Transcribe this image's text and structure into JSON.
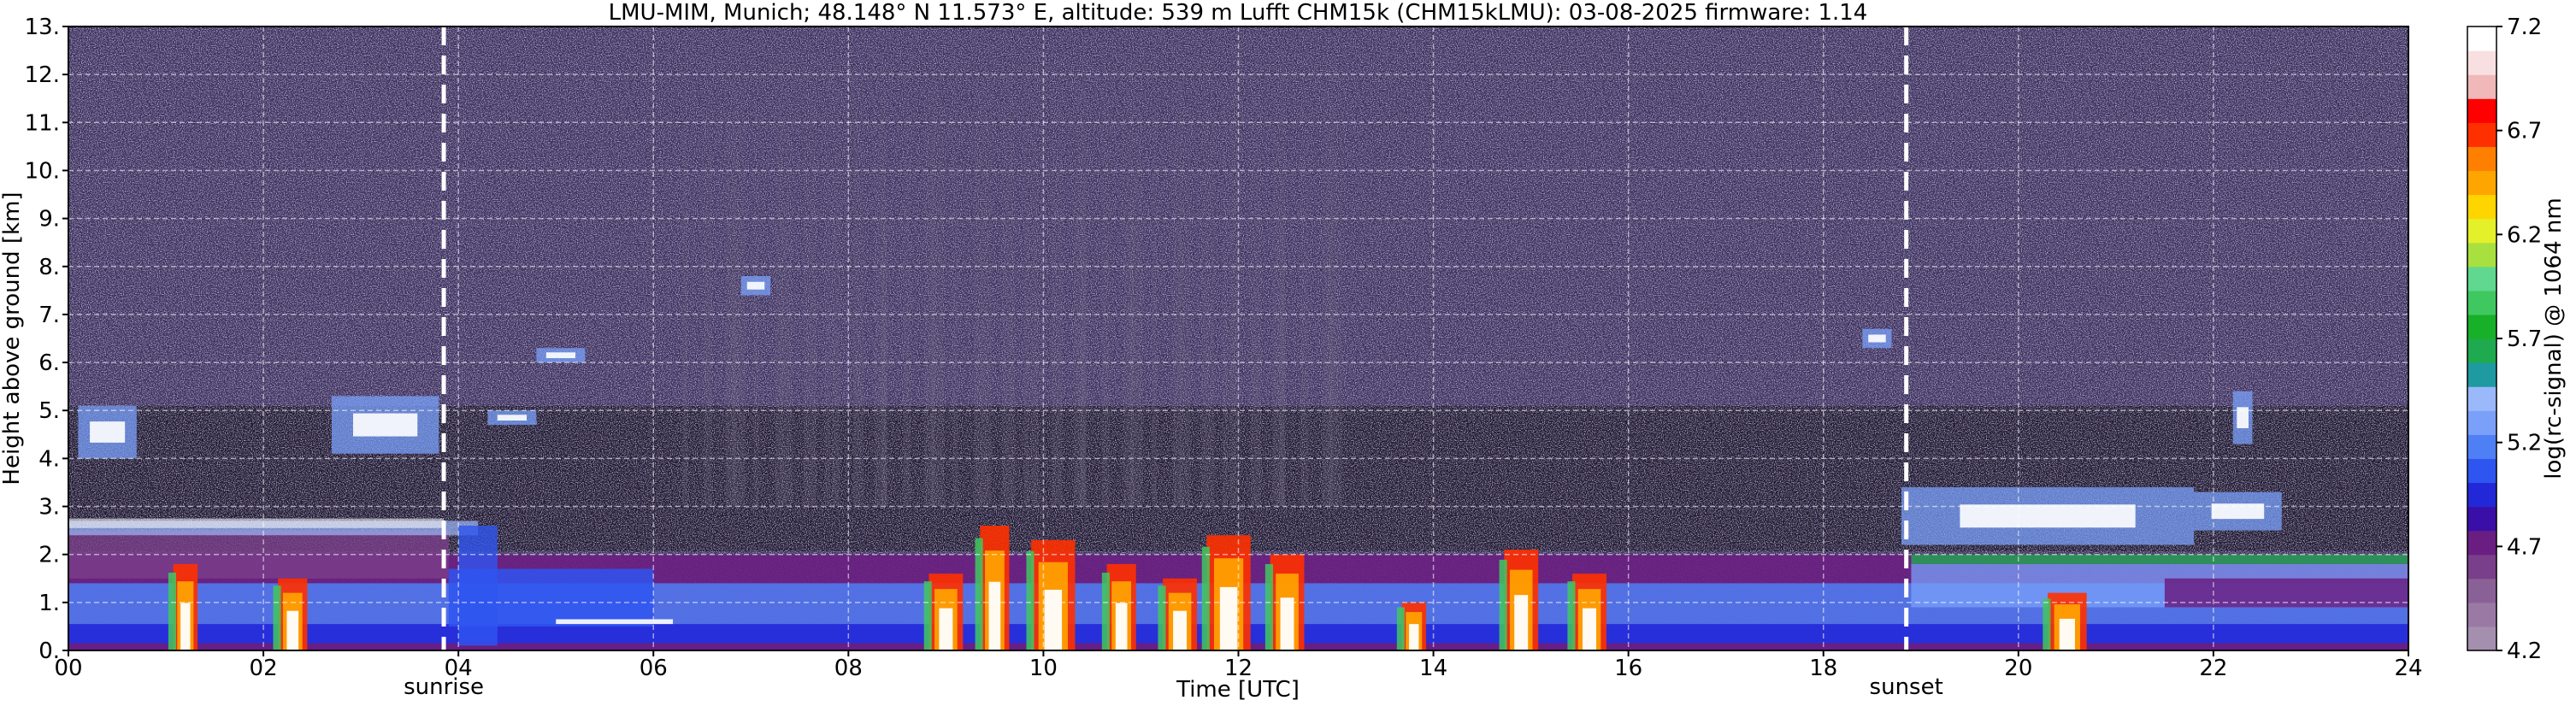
{
  "chart_data": {
    "type": "heatmap",
    "title": "LMU-MIM, Munich; 48.148° N 11.573° E, altitude: 539 m    Lufft CHM15k (CHM15kLMU): 03-08-2025    firmware: 1.14",
    "xlabel": "Time [UTC]",
    "ylabel": "Height above ground [km]",
    "xlim": [
      0,
      24
    ],
    "ylim": [
      0,
      13
    ],
    "x_ticks": [
      0,
      2,
      4,
      6,
      8,
      10,
      12,
      14,
      16,
      18,
      20,
      22,
      24
    ],
    "x_tick_labels": [
      "00",
      "02",
      "04",
      "06",
      "08",
      "10",
      "12",
      "14",
      "16",
      "18",
      "20",
      "22",
      "24"
    ],
    "y_ticks": [
      0,
      1,
      2,
      3,
      4,
      5,
      6,
      7,
      8,
      9,
      10,
      11,
      12,
      13
    ],
    "y_tick_labels": [
      "0.",
      "1.",
      "2.",
      "3.",
      "4.",
      "5.",
      "6.",
      "7.",
      "8.",
      "9.",
      "10.",
      "11.",
      "12.",
      "13."
    ],
    "grid": true,
    "markers": [
      {
        "label": "sunrise",
        "time": 3.85
      },
      {
        "label": "sunset",
        "time": 18.85
      }
    ],
    "colorbar": {
      "label": "log(rc-signal) @ 1064 nm",
      "range": [
        4.2,
        7.2
      ],
      "ticks": [
        4.2,
        4.7,
        5.2,
        5.7,
        6.2,
        6.7,
        7.2
      ],
      "tick_labels": [
        "4.2",
        "4.7",
        "5.2",
        "5.7",
        "6.2",
        "6.7",
        "7.2"
      ],
      "colors": [
        "#a58fae",
        "#9a7aa5",
        "#8a6197",
        "#7a3f8a",
        "#6a1e82",
        "#3a0fa8",
        "#2228d8",
        "#2f55f0",
        "#4f7ff5",
        "#7aa0fa",
        "#9bb8fb",
        "#1f9aa0",
        "#1faa50",
        "#18b028",
        "#40c860",
        "#60d890",
        "#a8e040",
        "#e4f02a",
        "#ffd500",
        "#ffa500",
        "#ff8000",
        "#ff3000",
        "#ff0000",
        "#f0b8b8",
        "#f8e0e0",
        "#ffffff"
      ]
    }
  }
}
